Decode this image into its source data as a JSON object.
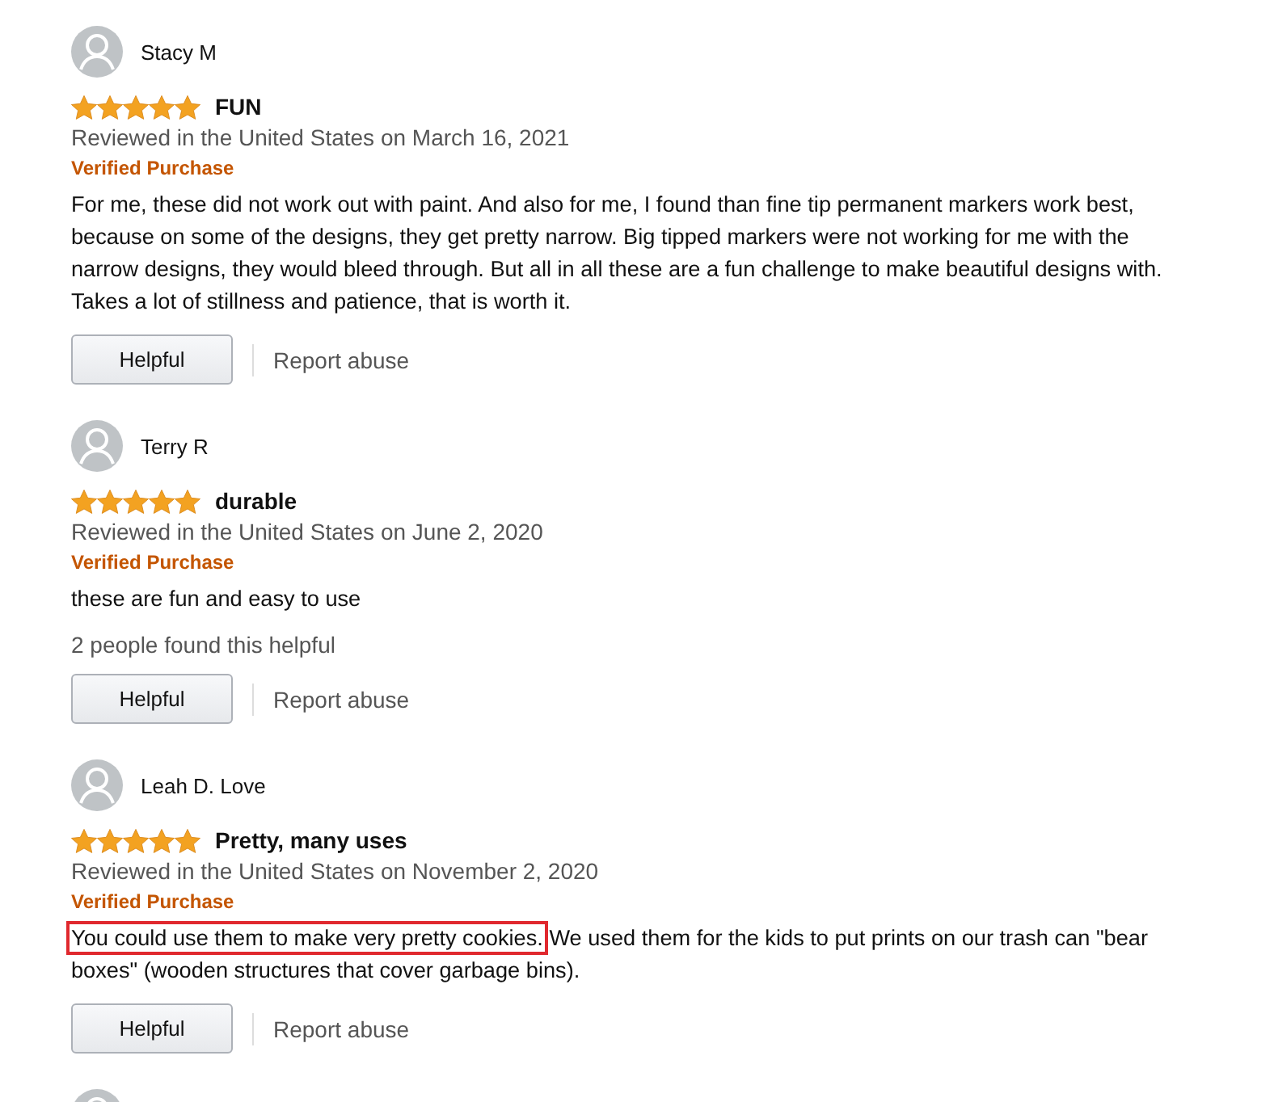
{
  "reviews": [
    {
      "kind": "full",
      "author": "Stacy M",
      "stars": 5,
      "title": "FUN",
      "date": "Reviewed in the United States on March 16, 2021",
      "badge": "Verified Purchase",
      "body": "For me, these did not work out with paint. And also for me, I found than fine tip permanent markers work best, because on some of the designs, they get pretty narrow. Big tipped markers were not working for me with the narrow designs, they would bleed through. But all in all these are a fun challenge to make beautiful designs with. Takes a lot of stillness and patience, that is worth it.",
      "helpful_button": "Helpful",
      "report_link": "Report abuse"
    },
    {
      "kind": "full",
      "author": "Terry R",
      "stars": 5,
      "title": "durable",
      "date": "Reviewed in the United States on June 2, 2020",
      "badge": "Verified Purchase",
      "body": "these are fun and easy to use",
      "helpful_count": "2 people found this helpful",
      "helpful_button": "Helpful",
      "report_link": "Report abuse"
    },
    {
      "kind": "full",
      "author": "Leah D. Love",
      "stars": 5,
      "title": "Pretty, many uses",
      "date": "Reviewed in the United States on November 2, 2020",
      "badge": "Verified Purchase",
      "body_highlight": {
        "text": "You could use them to make very pretty cookies.",
        "highlighted": true
      },
      "body": " We used them for the kids to put prints on our trash can \"bear boxes\" (wooden structures that cover garbage bins).",
      "helpful_button": "Helpful",
      "report_link": "Report abuse"
    },
    {
      "kind": "cut"
    }
  ]
}
